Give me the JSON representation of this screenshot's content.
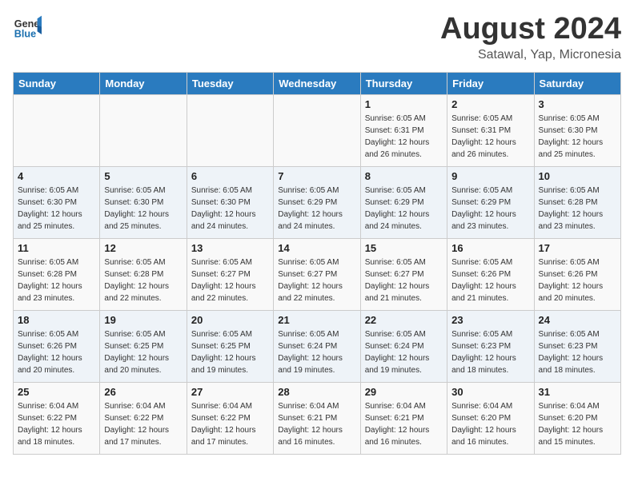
{
  "header": {
    "logo_general": "General",
    "logo_blue": "Blue",
    "title": "August 2024",
    "subtitle": "Satawal, Yap, Micronesia"
  },
  "days_of_week": [
    "Sunday",
    "Monday",
    "Tuesday",
    "Wednesday",
    "Thursday",
    "Friday",
    "Saturday"
  ],
  "weeks": [
    [
      {
        "day": "",
        "info": ""
      },
      {
        "day": "",
        "info": ""
      },
      {
        "day": "",
        "info": ""
      },
      {
        "day": "",
        "info": ""
      },
      {
        "day": "1",
        "info": "Sunrise: 6:05 AM\nSunset: 6:31 PM\nDaylight: 12 hours\nand 26 minutes."
      },
      {
        "day": "2",
        "info": "Sunrise: 6:05 AM\nSunset: 6:31 PM\nDaylight: 12 hours\nand 26 minutes."
      },
      {
        "day": "3",
        "info": "Sunrise: 6:05 AM\nSunset: 6:30 PM\nDaylight: 12 hours\nand 25 minutes."
      }
    ],
    [
      {
        "day": "4",
        "info": "Sunrise: 6:05 AM\nSunset: 6:30 PM\nDaylight: 12 hours\nand 25 minutes."
      },
      {
        "day": "5",
        "info": "Sunrise: 6:05 AM\nSunset: 6:30 PM\nDaylight: 12 hours\nand 25 minutes."
      },
      {
        "day": "6",
        "info": "Sunrise: 6:05 AM\nSunset: 6:30 PM\nDaylight: 12 hours\nand 24 minutes."
      },
      {
        "day": "7",
        "info": "Sunrise: 6:05 AM\nSunset: 6:29 PM\nDaylight: 12 hours\nand 24 minutes."
      },
      {
        "day": "8",
        "info": "Sunrise: 6:05 AM\nSunset: 6:29 PM\nDaylight: 12 hours\nand 24 minutes."
      },
      {
        "day": "9",
        "info": "Sunrise: 6:05 AM\nSunset: 6:29 PM\nDaylight: 12 hours\nand 23 minutes."
      },
      {
        "day": "10",
        "info": "Sunrise: 6:05 AM\nSunset: 6:28 PM\nDaylight: 12 hours\nand 23 minutes."
      }
    ],
    [
      {
        "day": "11",
        "info": "Sunrise: 6:05 AM\nSunset: 6:28 PM\nDaylight: 12 hours\nand 23 minutes."
      },
      {
        "day": "12",
        "info": "Sunrise: 6:05 AM\nSunset: 6:28 PM\nDaylight: 12 hours\nand 22 minutes."
      },
      {
        "day": "13",
        "info": "Sunrise: 6:05 AM\nSunset: 6:27 PM\nDaylight: 12 hours\nand 22 minutes."
      },
      {
        "day": "14",
        "info": "Sunrise: 6:05 AM\nSunset: 6:27 PM\nDaylight: 12 hours\nand 22 minutes."
      },
      {
        "day": "15",
        "info": "Sunrise: 6:05 AM\nSunset: 6:27 PM\nDaylight: 12 hours\nand 21 minutes."
      },
      {
        "day": "16",
        "info": "Sunrise: 6:05 AM\nSunset: 6:26 PM\nDaylight: 12 hours\nand 21 minutes."
      },
      {
        "day": "17",
        "info": "Sunrise: 6:05 AM\nSunset: 6:26 PM\nDaylight: 12 hours\nand 20 minutes."
      }
    ],
    [
      {
        "day": "18",
        "info": "Sunrise: 6:05 AM\nSunset: 6:26 PM\nDaylight: 12 hours\nand 20 minutes."
      },
      {
        "day": "19",
        "info": "Sunrise: 6:05 AM\nSunset: 6:25 PM\nDaylight: 12 hours\nand 20 minutes."
      },
      {
        "day": "20",
        "info": "Sunrise: 6:05 AM\nSunset: 6:25 PM\nDaylight: 12 hours\nand 19 minutes."
      },
      {
        "day": "21",
        "info": "Sunrise: 6:05 AM\nSunset: 6:24 PM\nDaylight: 12 hours\nand 19 minutes."
      },
      {
        "day": "22",
        "info": "Sunrise: 6:05 AM\nSunset: 6:24 PM\nDaylight: 12 hours\nand 19 minutes."
      },
      {
        "day": "23",
        "info": "Sunrise: 6:05 AM\nSunset: 6:23 PM\nDaylight: 12 hours\nand 18 minutes."
      },
      {
        "day": "24",
        "info": "Sunrise: 6:05 AM\nSunset: 6:23 PM\nDaylight: 12 hours\nand 18 minutes."
      }
    ],
    [
      {
        "day": "25",
        "info": "Sunrise: 6:04 AM\nSunset: 6:22 PM\nDaylight: 12 hours\nand 18 minutes."
      },
      {
        "day": "26",
        "info": "Sunrise: 6:04 AM\nSunset: 6:22 PM\nDaylight: 12 hours\nand 17 minutes."
      },
      {
        "day": "27",
        "info": "Sunrise: 6:04 AM\nSunset: 6:22 PM\nDaylight: 12 hours\nand 17 minutes."
      },
      {
        "day": "28",
        "info": "Sunrise: 6:04 AM\nSunset: 6:21 PM\nDaylight: 12 hours\nand 16 minutes."
      },
      {
        "day": "29",
        "info": "Sunrise: 6:04 AM\nSunset: 6:21 PM\nDaylight: 12 hours\nand 16 minutes."
      },
      {
        "day": "30",
        "info": "Sunrise: 6:04 AM\nSunset: 6:20 PM\nDaylight: 12 hours\nand 16 minutes."
      },
      {
        "day": "31",
        "info": "Sunrise: 6:04 AM\nSunset: 6:20 PM\nDaylight: 12 hours\nand 15 minutes."
      }
    ]
  ]
}
